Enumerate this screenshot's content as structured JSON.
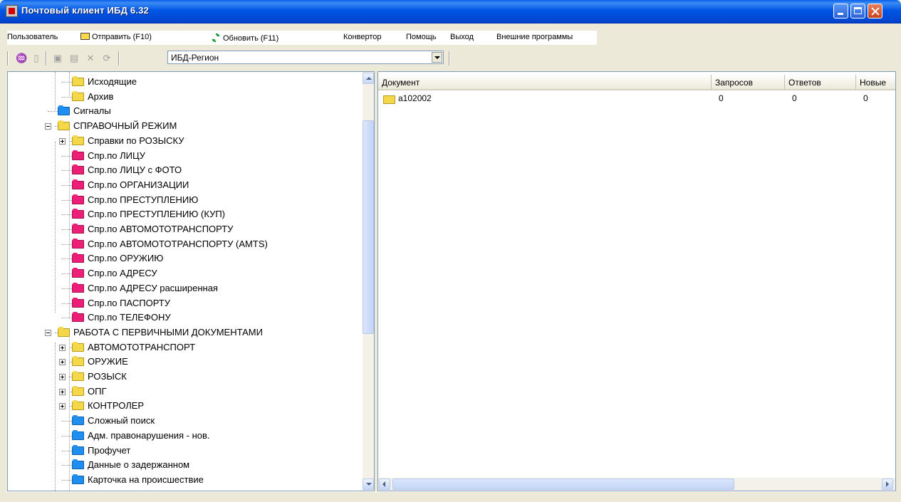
{
  "window": {
    "title": "Почтовый клиент ИБД 6.32"
  },
  "menu": {
    "user": "Пользователь",
    "send": "Отправить (F10)",
    "refresh": "Обновить (F11)",
    "converter": "Конвертор",
    "help": "Помощь",
    "exit": "Выход",
    "external": "Внешние программы"
  },
  "toolbar": {
    "region_select": "ИБД-Регион"
  },
  "tree": {
    "items": [
      "Исходящие",
      "Архив",
      "Сигналы",
      "СПРАВОЧНЫЙ РЕЖИМ",
      "Справки по РОЗЫСКУ",
      "Спр.по ЛИЦУ",
      "Спр.по ЛИЦУ с ФОТО",
      "Спр.по ОРГАНИЗАЦИИ",
      "Спр.по ПРЕСТУПЛЕНИЮ",
      "Спр.по ПРЕСТУПЛЕНИЮ (КУП)",
      "Спр.по АВТОМОТОТРАНСПОРТУ",
      "Спр.по АВТОМОТОТРАНСПОРТУ (AMTS)",
      "Спр.по ОРУЖИЮ",
      "Спр.по АДРЕСУ",
      "Спр.по АДРЕСУ расширенная",
      "Спр.по ПАСПОРТУ",
      "Спр.по ТЕЛЕФОНУ",
      "РАБОТА С ПЕРВИЧНЫМИ ДОКУМЕНТАМИ",
      "АВТОМОТОТРАНСПОРТ",
      "ОРУЖИЕ",
      "РОЗЫСК",
      "ОПГ",
      "КОНТРОЛЕР",
      "Сложный поиск",
      "Адм. правонарушения - нов.",
      "Профучет",
      "Данные о задержанном",
      "Карточка на происшествие"
    ]
  },
  "list": {
    "columns": [
      "Документ",
      "Запросов",
      "Ответов",
      "Новые"
    ],
    "rows": [
      {
        "doc": "a102002",
        "requests": "0",
        "answers": "0",
        "new": "0"
      }
    ]
  }
}
